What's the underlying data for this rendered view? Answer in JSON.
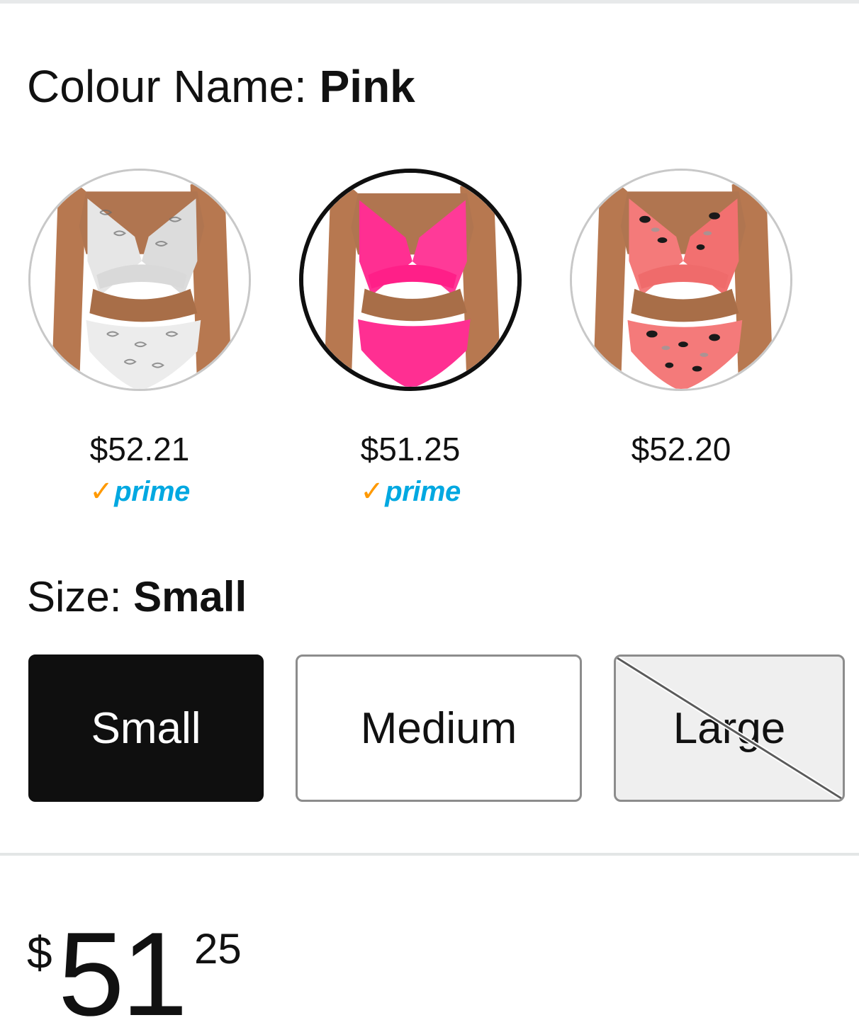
{
  "colour": {
    "label": "Colour Name:",
    "selected": "Pink"
  },
  "swatches": [
    {
      "name": "snakeskin",
      "price": "$52.21",
      "prime": true,
      "prime_label": "prime",
      "selected": false,
      "primary_color": "#e9e9e9"
    },
    {
      "name": "pink",
      "price": "$51.25",
      "prime": true,
      "prime_label": "prime",
      "selected": true,
      "primary_color": "#ff2f92"
    },
    {
      "name": "leopard",
      "price": "$52.20",
      "prime": false,
      "selected": false,
      "primary_color": "#f47a7a"
    }
  ],
  "size": {
    "label": "Size:",
    "selected": "Small",
    "options": [
      {
        "label": "Small",
        "state": "selected"
      },
      {
        "label": "Medium",
        "state": "available"
      },
      {
        "label": "Large",
        "state": "unavailable"
      }
    ]
  },
  "price": {
    "symbol": "$",
    "whole": "51",
    "fraction": "25"
  },
  "colors": {
    "prime_blue": "#00a8e1",
    "prime_check": "#ff9900",
    "selected_border": "#0f0f0f"
  }
}
